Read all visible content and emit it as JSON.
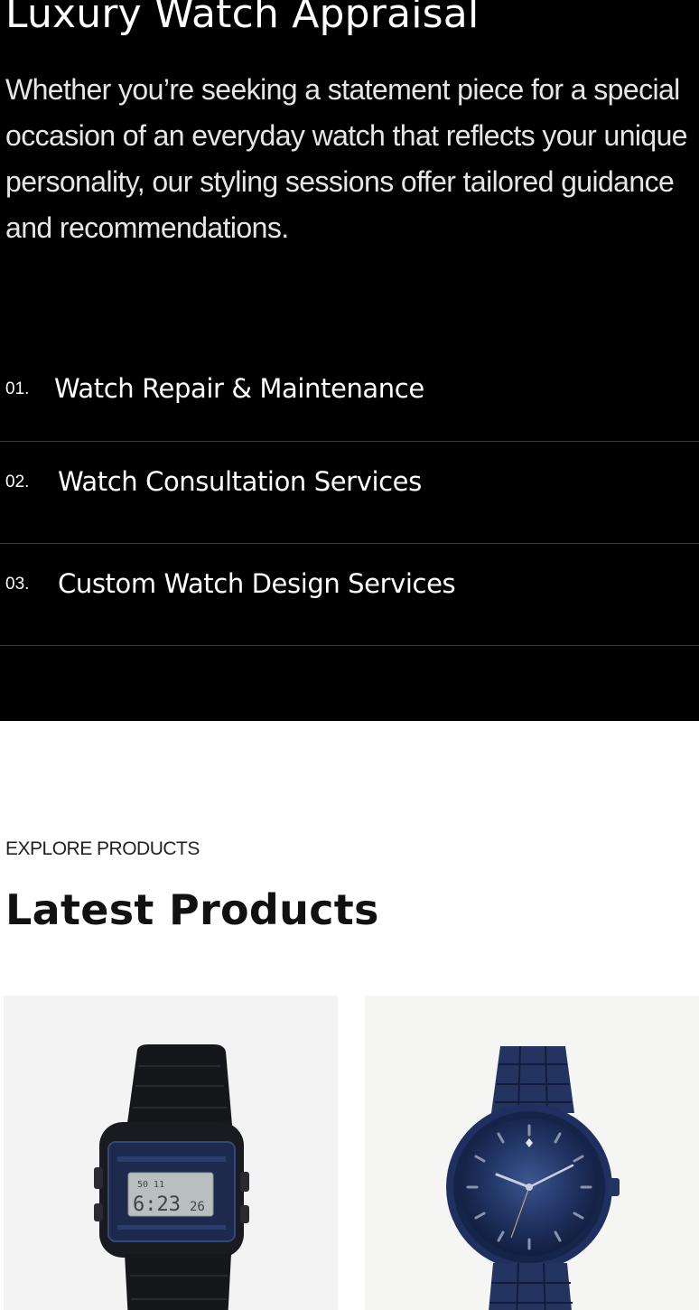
{
  "hero": {
    "title": "Luxury Watch Appraisal",
    "description": "Whether you’re seeking a statement piece for a special occasion of an everyday watch that reflects your unique personality, our styling sessions offer tailored guidance and recommendations."
  },
  "services": [
    {
      "number": "01.",
      "label": "Watch Repair & Maintenance"
    },
    {
      "number": "02.",
      "label": "Watch Consultation Services"
    },
    {
      "number": "03.",
      "label": "Custom Watch Design Services"
    }
  ],
  "products": {
    "eyebrow": "EXPLORE PRODUCTS",
    "title": "Latest Products",
    "items": [
      {
        "image_icon": "digital-watch-image",
        "display": "6:23",
        "seconds": "26",
        "top_digits": "50  11"
      },
      {
        "image_icon": "blue-analog-watch-image"
      }
    ]
  },
  "colors": {
    "dark_bg": "#000000",
    "divider": "#3a3a3a",
    "card_bg": "#f3f3f3",
    "watch_blue": "#1d2f5c"
  }
}
